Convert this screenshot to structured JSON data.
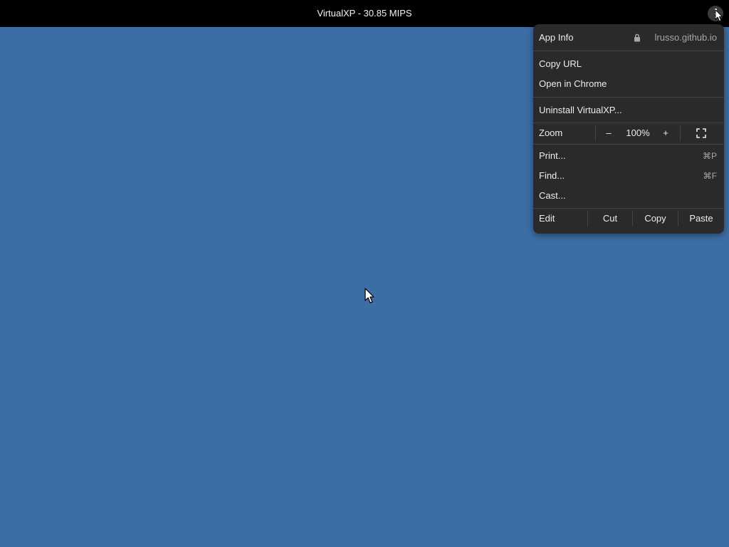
{
  "window": {
    "title": "VirtualXP - 30.85 MIPS"
  },
  "icons": {
    "menu_button": "three-dots-vertical-icon",
    "lock": "lock-icon",
    "fullscreen": "fullscreen-icon",
    "cursor": "mouse-pointer-icon"
  },
  "menu": {
    "app_info": {
      "label": "App Info",
      "host": "lrusso.github.io"
    },
    "copy_url": "Copy URL",
    "open_in_chrome": "Open in Chrome",
    "uninstall": "Uninstall VirtualXP...",
    "zoom": {
      "label": "Zoom",
      "minus": "–",
      "value": "100%",
      "plus": "+"
    },
    "print": {
      "label": "Print...",
      "shortcut": "⌘P"
    },
    "find": {
      "label": "Find...",
      "shortcut": "⌘F"
    },
    "cast": "Cast...",
    "edit": {
      "label": "Edit",
      "cut": "Cut",
      "copy": "Copy",
      "paste": "Paste"
    }
  },
  "colors": {
    "desktop": "#3c6ea5",
    "titlebar": "#000000",
    "menu_bg": "#2a2a2c"
  }
}
